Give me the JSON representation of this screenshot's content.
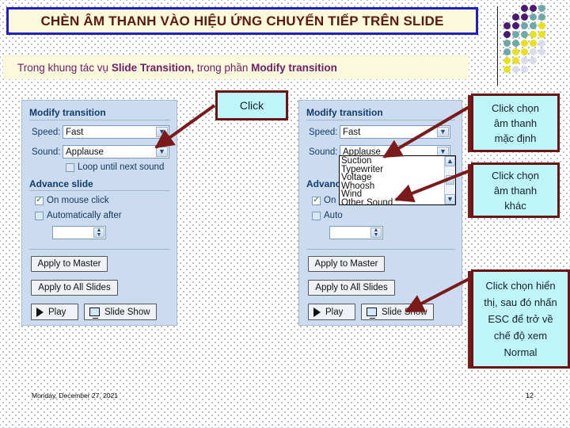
{
  "slide": {
    "title": "CHÈN ÂM THANH VÀO HIỆU ỨNG CHUYỂN TIẾP TRÊN SLIDE",
    "subtitle_plain_1": "Trong khung tác vụ ",
    "subtitle_bold_1": "Slide Transition,",
    "subtitle_plain_2": " trong phần ",
    "subtitle_bold_2": "Modify transition",
    "footer_date": "Monday, December 27, 2021",
    "page_number": "12"
  },
  "colors": {
    "title_text": "#5b1a0e",
    "title_border": "#2020c0",
    "title_fill": "#fdf9dc",
    "subtitle_text": "#6d2068",
    "callout_fill": "#bdf5f8",
    "callout_border": "#6b1414",
    "pane_fill": "#ccdcf0",
    "arrow": "#7b1a1a"
  },
  "pane_left": {
    "heading": "Modify transition",
    "speed_label": "Speed:",
    "speed_value": "Fast",
    "sound_label": "Sound:",
    "sound_value": "Applause",
    "loop_label": "Loop until next sound",
    "loop_checked": false,
    "advance_heading": "Advance slide",
    "on_mouse_click_label": "On mouse click",
    "on_mouse_click_checked": true,
    "automatically_after_label": "Automatically after",
    "automatically_after_checked": false,
    "automatically_after_value": "",
    "apply_to_master": "Apply to Master",
    "apply_to_all_slides": "Apply to All Slides",
    "play": "Play",
    "slide_show": "Slide Show"
  },
  "pane_right": {
    "heading": "Modify transition",
    "speed_label": "Speed:",
    "speed_value": "Fast",
    "sound_label": "Sound:",
    "sound_value": "Applause",
    "advance_heading": "Advance",
    "on_mouse_click_label": "On m",
    "on_mouse_click_checked": true,
    "automatically_after_label": "Auto",
    "automatically_after_checked": false,
    "apply_to_master": "Apply to Master",
    "apply_to_all_slides": "Apply to All Slides",
    "play": "Play",
    "slide_show": "Slide Show",
    "dropdown_options": [
      "Suction",
      "Typewriter",
      "Voltage",
      "Whoosh",
      "Wind",
      "Other Sound…"
    ]
  },
  "callouts": {
    "click": "Click",
    "default_sound": "Click chọn\nâm thanh\nmặc định",
    "other_sound": "Click chọn\nâm thanh\nkhác",
    "slide_show": "Click chọn hiển\nthị, sau đó nhấn\nESC để trở về\nchế độ xem\nNormal"
  },
  "decoration": {
    "dot_grid_description": "diagonal gradient dot grid",
    "dot_colors": [
      "#4a1a72",
      "#6fa8a8",
      "#e8e020",
      "#dcdcf0"
    ]
  }
}
